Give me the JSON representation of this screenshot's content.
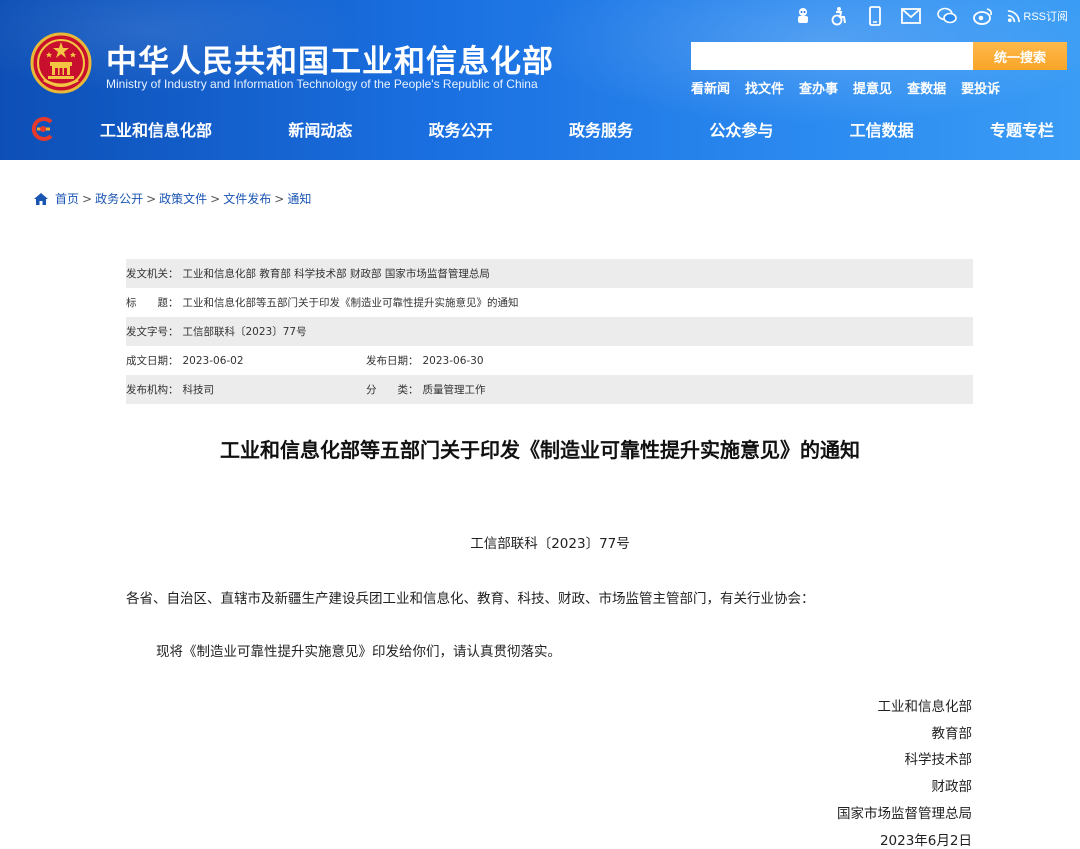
{
  "header": {
    "title_zh": "中华人民共和国工业和信息化部",
    "title_en": "Ministry of Industry and Information Technology of the People's Republic of China",
    "toolbar_icons": [
      "robot-icon",
      "accessibility-icon",
      "mobile-icon",
      "mail-icon",
      "wechat-icon",
      "weibo-icon"
    ],
    "rss_label": "RSS订阅",
    "search_placeholder": "",
    "search_button": "统一搜索",
    "quick_links": [
      "看新闻",
      "找文件",
      "查办事",
      "提意见",
      "查数据",
      "要投诉"
    ],
    "brand_color": "#1a6fe0",
    "accent_color": "#f7a528"
  },
  "nav": {
    "items": [
      "工业和信息化部",
      "新闻动态",
      "政务公开",
      "政务服务",
      "公众参与",
      "工信数据",
      "专题专栏"
    ]
  },
  "breadcrumb": {
    "items": [
      "首页",
      "政务公开",
      "政策文件",
      "文件发布",
      "通知"
    ],
    "separator": ">"
  },
  "meta": {
    "issuer_label": "发文机关：",
    "issuer": "工业和信息化部 教育部 科学技术部 财政部 国家市场监督管理总局",
    "title_label": "标　　题：",
    "title": "工业和信息化部等五部门关于印发《制造业可靠性提升实施意见》的通知",
    "docno_label": "发文字号：",
    "docno": "工信部联科〔2023〕77号",
    "written_label": "成文日期：",
    "written": "2023-06-02",
    "published_label": "发布日期：",
    "published": "2023-06-30",
    "org_label": "发布机构：",
    "org": "科技司",
    "category_label": "分　　类：",
    "category": "质量管理工作"
  },
  "article": {
    "title": "工业和信息化部等五部门关于印发《制造业可靠性提升实施意见》的通知",
    "doc_number": "工信部联科〔2023〕77号",
    "recipients": "各省、自治区、直辖市及新疆生产建设兵团工业和信息化、教育、科技、财政、市场监管主管部门，有关行业协会：",
    "body": "现将《制造业可靠性提升实施意见》印发给你们，请认真贯彻落实。",
    "signers": [
      "工业和信息化部",
      "教育部",
      "科学技术部",
      "财政部",
      "国家市场监督管理总局",
      "2023年6月2日"
    ]
  }
}
